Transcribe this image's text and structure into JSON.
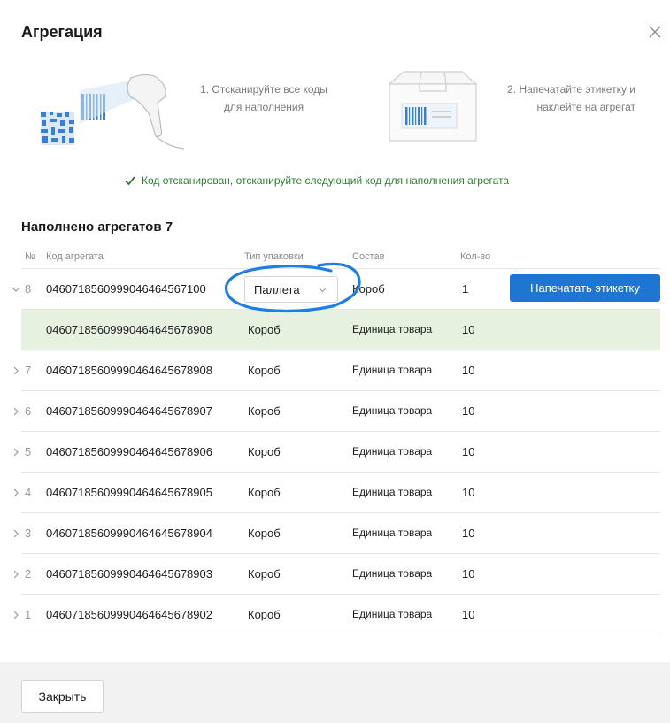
{
  "dialog": {
    "title": "Агрегация",
    "close_button_label": "Закрыть"
  },
  "instructions": {
    "step1": "1. Отсканируйте все коды для наполнения",
    "step2": "2. Напечатайте этикетку и наклейте на агрегат"
  },
  "status": {
    "message": "Код отсканирован, отсканируйте следующий код для наполнения агрегата",
    "color": "#2e7d32"
  },
  "summary": {
    "title": "Наполнено агрегатов 7"
  },
  "table": {
    "headers": {
      "num": "№",
      "code": "Код агрегата",
      "package_type": "Тип упаковки",
      "composition": "Состав",
      "quantity": "Кол-во"
    },
    "active_row": {
      "num": "8",
      "code": "0460718560999046464567100",
      "package_type_selected": "Паллета",
      "composition": "Короб",
      "quantity": "1",
      "print_label": "Напечатать этикетку"
    },
    "sub_row": {
      "code": "0460718560999046464567890 8",
      "package_type": "Короб",
      "composition": "Единица товара",
      "quantity": "10"
    },
    "rows": [
      {
        "num": "7",
        "code": "04607185609990464645678908",
        "package_type": "Короб",
        "composition": "Единица товара",
        "quantity": "10"
      },
      {
        "num": "6",
        "code": "04607185609990464645678907",
        "package_type": "Короб",
        "composition": "Единица товара",
        "quantity": "10"
      },
      {
        "num": "5",
        "code": "04607185609990464645678906",
        "package_type": "Короб",
        "composition": "Единица товара",
        "quantity": "10"
      },
      {
        "num": "4",
        "code": "04607185609990464645678905",
        "package_type": "Короб",
        "composition": "Единица товара",
        "quantity": "10"
      },
      {
        "num": "3",
        "code": "04607185609990464645678904",
        "package_type": "Короб",
        "composition": "Единица товара",
        "quantity": "10"
      },
      {
        "num": "2",
        "code": "04607185609990464645678903",
        "package_type": "Короб",
        "composition": "Единица товара",
        "quantity": "10"
      },
      {
        "num": "1",
        "code": "04607185609990464645678902",
        "package_type": "Короб",
        "composition": "Единица товара",
        "quantity": "10"
      }
    ]
  },
  "colors": {
    "primary": "#1f76d2",
    "highlight_row": "#e6f2df",
    "annotation_circle": "#1f7fe0"
  }
}
